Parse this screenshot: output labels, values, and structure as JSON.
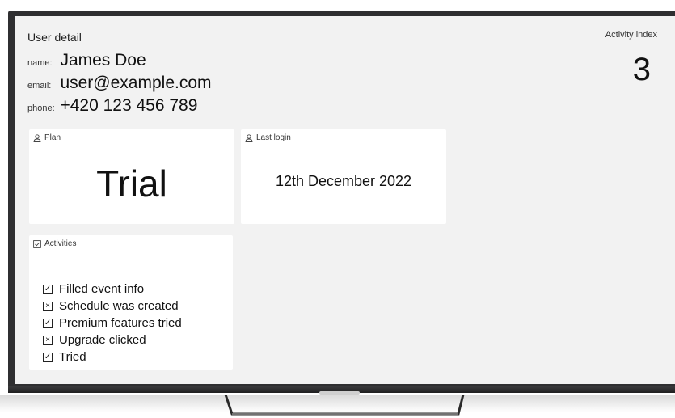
{
  "header": {
    "title": "User detail"
  },
  "user": {
    "name_label": "name:",
    "name": "James Doe",
    "email_label": "email:",
    "email": "user@example.com",
    "phone_label": "phone:",
    "phone": "+420 123 456 789"
  },
  "activity_index": {
    "label": "Activity index",
    "value": "3"
  },
  "plan": {
    "label": "Plan",
    "icon": "user-icon",
    "value": "Trial"
  },
  "last_login": {
    "label": "Last login",
    "icon": "user-icon",
    "value": "12th December 2022"
  },
  "activities": {
    "label": "Activities",
    "icon": "checkbox-icon",
    "items": [
      {
        "label": "Filled event info",
        "checked": true,
        "mark": "✓"
      },
      {
        "label": "Schedule was created",
        "checked": false,
        "mark": "×"
      },
      {
        "label": "Premium features tried",
        "checked": true,
        "mark": "✓"
      },
      {
        "label": "Upgrade clicked",
        "checked": false,
        "mark": "×"
      },
      {
        "label": "Tried",
        "checked": true,
        "mark": "✓"
      }
    ]
  }
}
